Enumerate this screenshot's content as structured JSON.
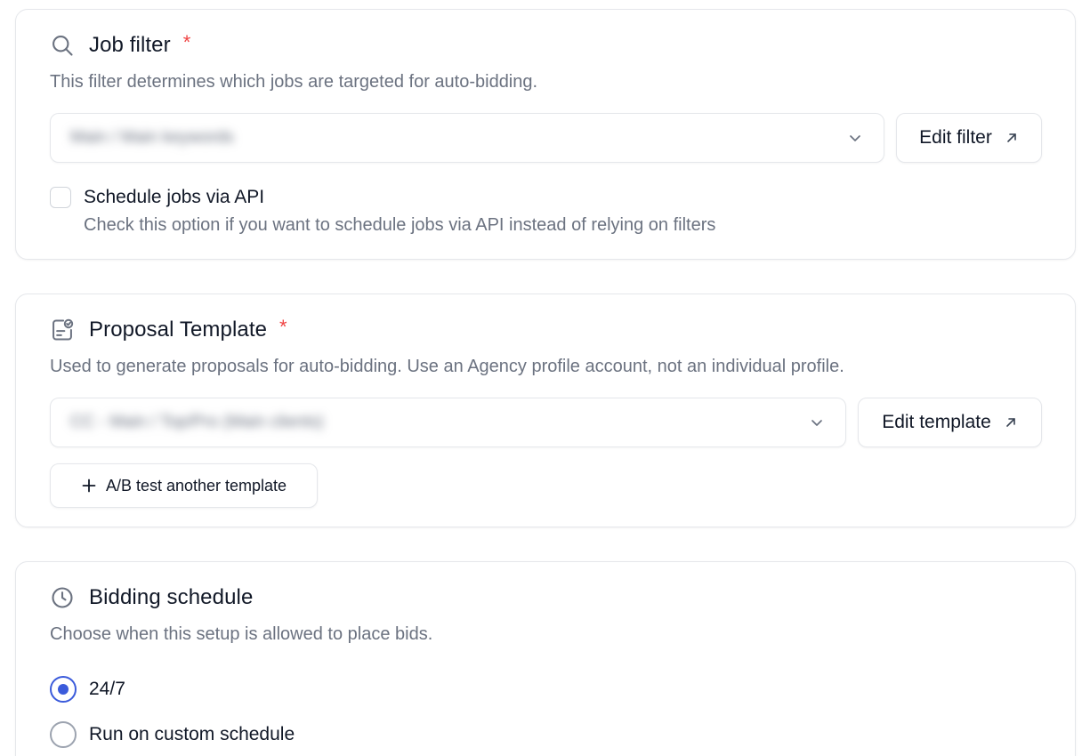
{
  "job_filter": {
    "title": "Job filter",
    "required_mark": "*",
    "description": "This filter determines which jobs are targeted for auto-bidding.",
    "select_value": "Main / Main keywords",
    "edit_button_label": "Edit filter",
    "api_checkbox": {
      "label": "Schedule jobs via API",
      "help": "Check this option if you want to schedule jobs via API instead of relying on filters",
      "checked": false
    }
  },
  "proposal_template": {
    "title": "Proposal Template",
    "required_mark": "*",
    "description": "Used to generate proposals for auto-bidding. Use an Agency profile account, not an individual profile.",
    "select_value": "CC - Main / Top/Pro (Main clients)",
    "edit_button_label": "Edit template",
    "ab_test_button_label": "A/B test another template"
  },
  "bidding_schedule": {
    "title": "Bidding schedule",
    "description": "Choose when this setup is allowed to place bids.",
    "options": [
      {
        "label": "24/7",
        "checked": true
      },
      {
        "label": "Run on custom schedule",
        "checked": false
      }
    ]
  },
  "icons": {
    "job_filter": "search-icon",
    "proposal_template": "template-check-icon",
    "bidding_schedule": "clock-icon",
    "select": "chevron-down-icon",
    "edit": "arrow-up-right-icon",
    "ab_test": "plus-icon"
  },
  "colors": {
    "required": "#ef4444",
    "radio_checked": "#3b5bdb",
    "muted_text": "#6b7280",
    "border": "#e5e7eb"
  }
}
